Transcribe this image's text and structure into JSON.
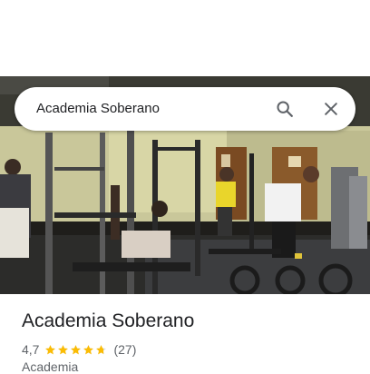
{
  "search": {
    "query": "Academia Soberano"
  },
  "place": {
    "title": "Academia Soberano",
    "rating": "4,7",
    "rating_fraction": 0.94,
    "review_count": "(27)",
    "category": "Academia"
  },
  "icons": {
    "search": "search-icon",
    "close": "close-icon",
    "star": "star-icon"
  },
  "colors": {
    "star": "#fbbc04",
    "text_primary": "#202124",
    "text_secondary": "#5f6368"
  }
}
